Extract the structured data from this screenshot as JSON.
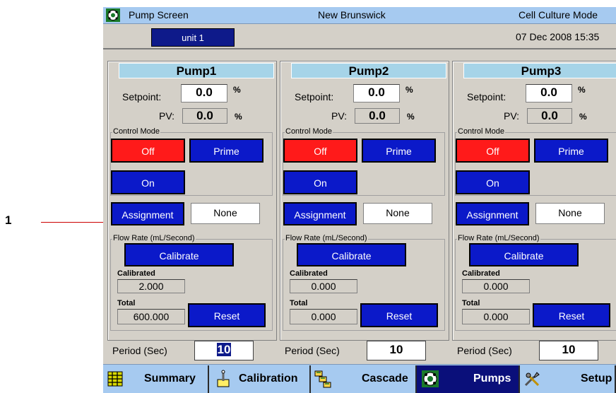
{
  "callout": {
    "number": "1"
  },
  "title_bar": {
    "screen": "Pump Screen",
    "vendor": "New Brunswick",
    "mode": "Cell Culture Mode"
  },
  "top_bar": {
    "unit": "unit 1",
    "datetime": "07 Dec 2008  15:35"
  },
  "labels": {
    "setpoint": "Setpoint:",
    "pv": "PV:",
    "percent": "%",
    "control_mode": "Control Mode",
    "flow_rate": "Flow Rate (mL/Second)",
    "calibrated": "Calibrated",
    "total": "Total",
    "period": "Period (Sec)"
  },
  "buttons": {
    "off": "Off",
    "prime": "Prime",
    "on": "On",
    "assignment": "Assignment",
    "calibrate": "Calibrate",
    "reset": "Reset"
  },
  "colors": {
    "off_active": "#ff1a1a",
    "button_blue": "#0b19c9",
    "title_bar": "#a6caf0",
    "panel_header": "#a6d4e8"
  },
  "pumps": [
    {
      "name": "Pump1",
      "setpoint": "0.0",
      "pv": "0.0",
      "assignment": "None",
      "calibrated": "2.000",
      "total": "600.000",
      "period": "10",
      "period_selected": true
    },
    {
      "name": "Pump2",
      "setpoint": "0.0",
      "pv": "0.0",
      "assignment": "None",
      "calibrated": "0.000",
      "total": "0.000",
      "period": "10",
      "period_selected": false
    },
    {
      "name": "Pump3",
      "setpoint": "0.0",
      "pv": "0.0",
      "assignment": "None",
      "calibrated": "0.000",
      "total": "0.000",
      "period": "10",
      "period_selected": false
    }
  ],
  "nav": [
    {
      "label": "Summary",
      "icon": "grid-icon",
      "active": false
    },
    {
      "label": "Calibration",
      "icon": "probe-icon",
      "active": false
    },
    {
      "label": "Cascade",
      "icon": "cascade-icon",
      "active": false
    },
    {
      "label": "Pumps",
      "icon": "pump-icon",
      "active": true
    },
    {
      "label": "Setup",
      "icon": "tools-icon",
      "active": false
    }
  ]
}
